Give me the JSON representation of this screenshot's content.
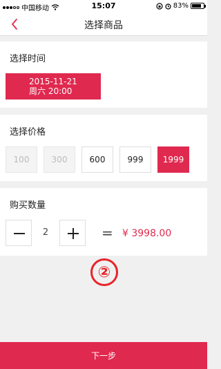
{
  "status_bar": {
    "carrier": "中国移动",
    "time": "15:07",
    "battery": "83%",
    "battery_level": 0.83
  },
  "nav": {
    "title": "选择商品",
    "back_icon": "chevron-left-icon"
  },
  "time_section": {
    "label": "选择时间",
    "selected_date": "2015-11-21",
    "selected_time": "周六 20:00"
  },
  "price_section": {
    "label": "选择价格",
    "options": [
      {
        "label": "100",
        "state": "disabled"
      },
      {
        "label": "300",
        "state": "disabled"
      },
      {
        "label": "600",
        "state": "available"
      },
      {
        "label": "999",
        "state": "available"
      },
      {
        "label": "1999",
        "state": "selected"
      }
    ]
  },
  "quantity_section": {
    "label": "购买数量",
    "quantity": "2",
    "equals": "=",
    "total": "¥ 3998.00"
  },
  "step_marker": "②",
  "footer": {
    "next_label": "下一步"
  },
  "colors": {
    "accent": "#e0294f",
    "step_marker": "#e8232a"
  }
}
